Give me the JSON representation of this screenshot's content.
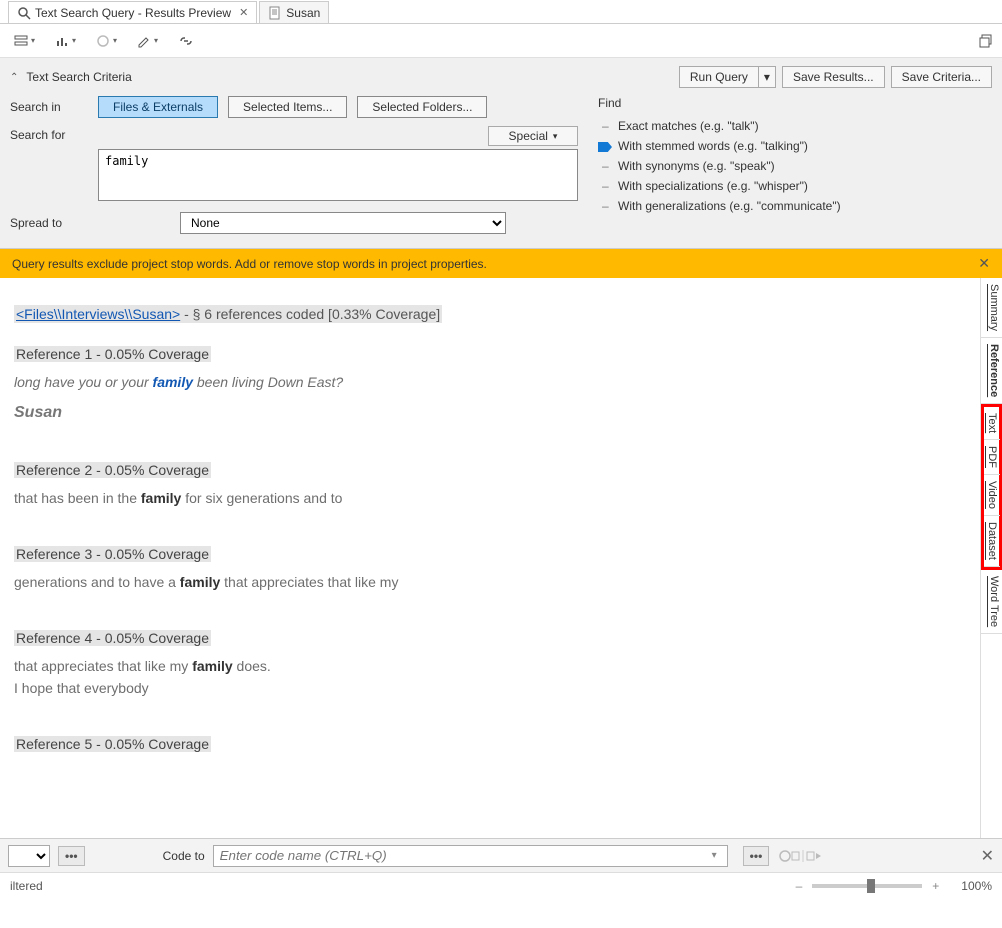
{
  "tabs": [
    {
      "title": "Text Search Query - Results Preview",
      "closeable": true
    },
    {
      "title": "Susan",
      "closeable": false
    }
  ],
  "criteria": {
    "header": "Text Search Criteria",
    "run_query": "Run Query",
    "save_results": "Save Results...",
    "save_criteria": "Save Criteria...",
    "search_in_label": "Search in",
    "scope_buttons": [
      "Files & Externals",
      "Selected Items...",
      "Selected Folders..."
    ],
    "search_for_label": "Search for",
    "special_label": "Special",
    "search_for_value": "family",
    "spread_to_label": "Spread to",
    "spread_to_value": "None",
    "find_label": "Find",
    "find_options": [
      "Exact matches (e.g. \"talk\")",
      "With stemmed words (e.g. \"talking\")",
      "With synonyms (e.g. \"speak\")",
      "With specializations (e.g. \"whisper\")",
      "With generalizations (e.g. \"communicate\")"
    ]
  },
  "warning": "Query results exclude project stop words. Add or remove stop words in project properties.",
  "source": {
    "link": "<Files\\\\Interviews\\\\Susan>",
    "suffix": " - § 6 references coded  [0.33% Coverage]"
  },
  "references": [
    {
      "head": "Reference 1 - 0.05% Coverage",
      "before": "long have you or your ",
      "kw": "family",
      "after": " been living Down East?",
      "italic": true,
      "speaker_after": "Susan"
    },
    {
      "head": "Reference 2 - 0.05% Coverage",
      "before": "that has been in the ",
      "kw": "family",
      "after": " for six generations and to"
    },
    {
      "head": "Reference 3 - 0.05% Coverage",
      "before": "generations and to have a ",
      "kw": "family",
      "after": " that appreciates that like my"
    },
    {
      "head": "Reference 4 - 0.05% Coverage",
      "before": "that appreciates that like my ",
      "kw": "family",
      "after": " does.",
      "extra": "I hope that everybody"
    },
    {
      "head": "Reference 5 - 0.05% Coverage"
    }
  ],
  "side_tabs": [
    "Summary",
    "Reference",
    "Text",
    "PDF",
    "Video",
    "Dataset",
    "Word Tree"
  ],
  "code_bar": {
    "label": "Code to",
    "placeholder": "Enter code name (CTRL+Q)"
  },
  "status": {
    "filtered": "iltered",
    "zoom": "100%"
  }
}
